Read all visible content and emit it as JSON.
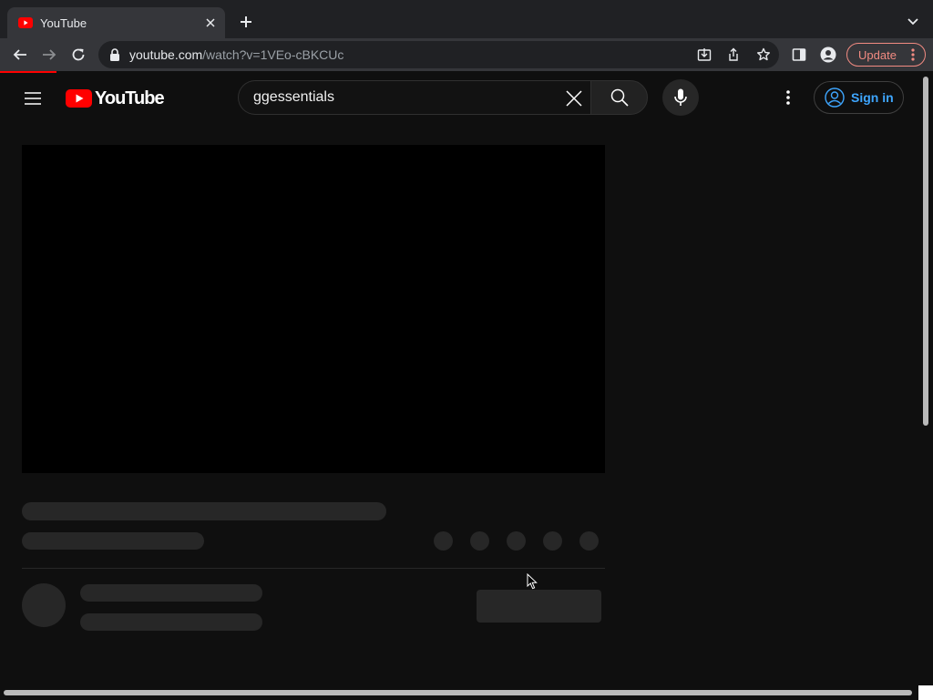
{
  "browser": {
    "tab": {
      "title": "YouTube",
      "favicon": "youtube-favicon-icon"
    },
    "url": {
      "host": "youtube.com",
      "path": "/watch?v=1VEo-cBKCUc"
    },
    "update_label": "Update"
  },
  "masthead": {
    "logo_text": "YouTube",
    "search": {
      "value": "ggessentials"
    },
    "signin_label": "Sign in"
  },
  "colors": {
    "youtube_red": "#ff0000",
    "background": "#0f0f0f",
    "skeleton": "#272727",
    "link_blue": "#3ea6ff",
    "update_accent": "#f28b82"
  },
  "page_state": "loading-skeleton"
}
